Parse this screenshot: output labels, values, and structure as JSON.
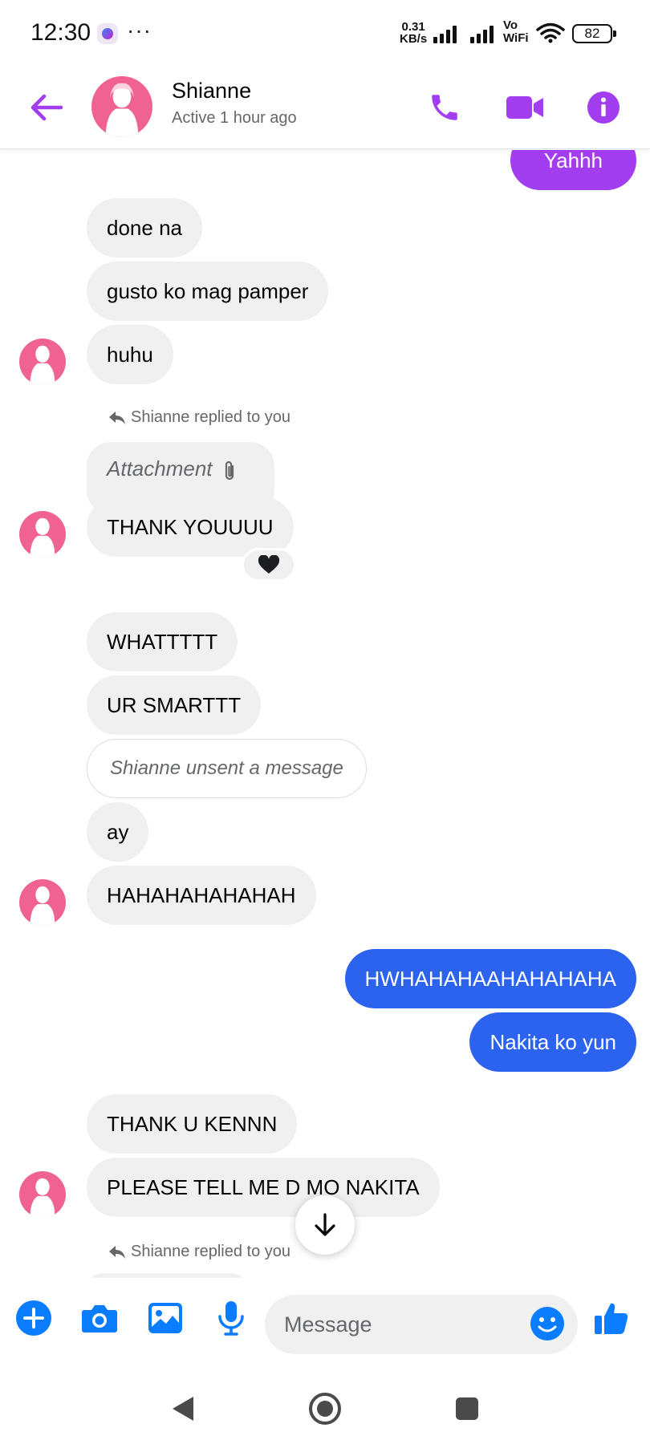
{
  "status_bar": {
    "time": "12:30",
    "more": "···",
    "net_speed_value": "0.31",
    "net_speed_unit": "KB/s",
    "vo": "Vo",
    "wifi_label": "WiFi",
    "battery": "82"
  },
  "header": {
    "contact_name": "Shianne",
    "active_status": "Active 1 hour ago",
    "accent_color": "#a33df0"
  },
  "messages": {
    "partial_outgoing": "Yahhh",
    "m1": "done na",
    "m2": "gusto ko mag pamper",
    "m3": "huhu",
    "reply_note_1": "Shianne replied to you",
    "attachment_label": "Attachment",
    "m4": "THANK YOUUUU",
    "m4_reaction": "black-heart",
    "m5": "WHATTTTT",
    "m6": "UR SMARTTT",
    "unsent_notice": "Shianne unsent a message",
    "m7": "ay",
    "m8": "HAHAHAHAHAHAH",
    "out1": "HWHAHAHAAHAHAHAHA",
    "out2": "Nakita ko yun",
    "m9": "THANK U KENNN",
    "m10": "PLEASE TELL ME D MO NAKITA",
    "reply_note_2": "Shianne replied to you"
  },
  "composer": {
    "placeholder": "Message",
    "icon_color": "#0a7cff"
  },
  "colors": {
    "incoming_bubble": "#f0f0f0",
    "outgoing_bubble": "#2b63ef",
    "avatar_pink": "#f06292"
  }
}
